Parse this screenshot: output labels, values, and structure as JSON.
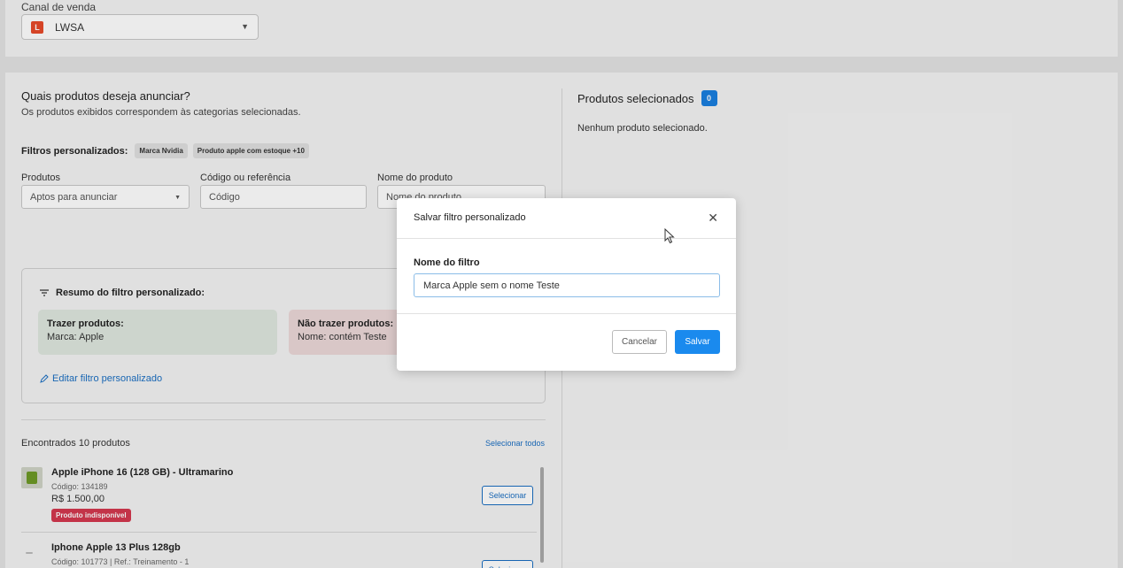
{
  "channel": {
    "label": "Canal de venda",
    "value": "LWSA",
    "logo_glyph": "L"
  },
  "left": {
    "question_title": "Quais produtos deseja anunciar?",
    "question_sub": "Os produtos exibidos correspondem às categorias selecionadas.",
    "filters_label": "Filtros personalizados:",
    "filter_chips": [
      "Marca Nvidia",
      "Produto apple com estoque +10"
    ],
    "fields": {
      "produtos_label": "Produtos",
      "produtos_value": "Aptos para anunciar",
      "codigo_label": "Código ou referência",
      "codigo_placeholder": "Código",
      "nome_label": "Nome do produto",
      "nome_placeholder": "Nome do produto"
    },
    "summary": {
      "title": "Resumo do filtro personalizado:",
      "include_title": "Trazer produtos:",
      "include_value": "Marca: Apple",
      "exclude_title": "Não trazer produtos:",
      "exclude_value": "Nome: contém Teste",
      "edit_link": "Editar filtro personalizado"
    },
    "found_text": "Encontrados 10 produtos",
    "select_all": "Selecionar todos",
    "products": [
      {
        "name": "Apple iPhone 16 (128 GB) - Ultramarino",
        "code": "Código: 134189",
        "price": "R$ 1.500,00",
        "tag": "Produto indisponível",
        "button": "Selecionar"
      },
      {
        "name": "Iphone Apple 13 Plus 128gb",
        "code": "Código: 101773  |  Ref.: Treinamento - 1",
        "button": "Selecionar"
      }
    ]
  },
  "right": {
    "title": "Produtos selecionados",
    "count": "0",
    "empty": "Nenhum produto selecionado."
  },
  "modal": {
    "title": "Salvar filtro personalizado",
    "field_label": "Nome do filtro",
    "field_value": "Marca Apple sem o nome Teste",
    "cancel": "Cancelar",
    "save": "Salvar"
  },
  "colors": {
    "accent": "#1a8aee",
    "link": "#1a6ec2",
    "danger_tag": "#d4384f"
  }
}
